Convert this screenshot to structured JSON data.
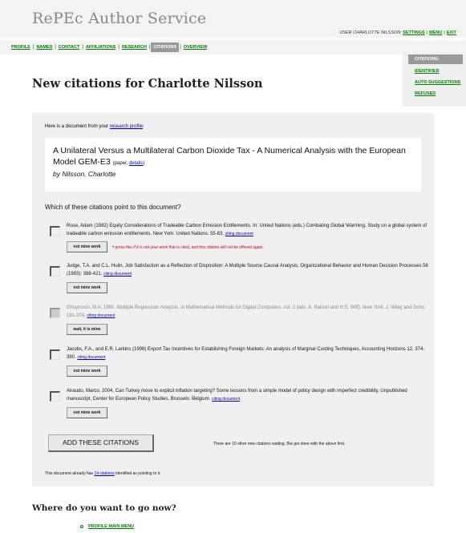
{
  "site": {
    "title": "RePEc Author Service"
  },
  "user_bar": {
    "prefix": "USER",
    "user_name": "CHARLOTTE NILSSON",
    "settings": "SETTINGS",
    "menu": "MENU",
    "exit": "EXIT"
  },
  "nav": {
    "items": [
      {
        "label": "PROFILE"
      },
      {
        "label": "NAMES"
      },
      {
        "label": "CONTACT"
      },
      {
        "label": "AFFILIATIONS"
      },
      {
        "label": "RESEARCH"
      },
      {
        "label": "CITATIONS",
        "active": true
      },
      {
        "label": "OVERVIEW"
      }
    ]
  },
  "side_panel": {
    "heading": "CITATIONS:",
    "links": [
      "IDENTIFIED",
      "AUTO SUGGESTIONS",
      "REFUSED"
    ]
  },
  "page": {
    "title": "New citations for Charlotte Nilsson"
  },
  "document": {
    "intro_prefix": "Here is a document from your",
    "intro_link": "research profile",
    "intro_suffix": ":",
    "title": "A Unilateral Versus a Multilateral Carbon Dioxide Tax - A Numerical Analysis with the European Model GEM-E3",
    "type": "(paper,",
    "details_link": "details",
    "details_suffix": ")",
    "author": "by Nilsson, Charlotte"
  },
  "question": "Which of these citations point to this document?",
  "citations": [
    {
      "text": "Rose, Adam (1992) Equity Considerations of Tradeable Carbon Emission Entitlements. In: United Nations (eds.) Combating Global Warming. Study on a global system of tradeable carbon emission entitlements. New York: United Nations. 55-83.",
      "link": "citing document",
      "button": "not mine work",
      "note_start": "press this",
      "note_em": "if it is not your work",
      "note_end": "that is cited, and this citation will not be offered again.",
      "checked": false
    },
    {
      "text": "Judge, T.A. and C.L. Hulin, Job Satisfaction as a Reflection of Disposition: A Multiple Source Causal Analysis, Organizational Behavior and Human Decision Processes 56 (1993): 388-421.",
      "link": "citing document",
      "button": "not mine work",
      "checked": false
    },
    {
      "text": "Efroymson, M.A. 1960. Multiple Regression Analysis, in Mathematical Methods for Digital Computers. vol. 1 (eds. A. Ralson and H.S. Wilf). New York: J. Wiley and Sons, 191-203.",
      "link": "citing document",
      "button": "wait, it is mine",
      "checked": true
    },
    {
      "text": "Jacobs, F.A., and E.R. Larkins (1998) Export Tax Incentives for Establishing Foreign Markets: An analysis of Marginal Costing Techniques, Accounting Horizons 12, 374-390.",
      "link": "citing document",
      "button": "not mine work",
      "checked": false
    },
    {
      "text": "Airaudo, Marco, 2004, Can Turkey move to explicit inflation targeting? Some lessons from a simple model of policy design with imperfect credibility, Unpublished manuscript, Center for European Policy Studies, Brussels: Belgium.",
      "link": "citing document",
      "button": "not mine work",
      "checked": false
    }
  ],
  "actions": {
    "add_button": "ADD THESE CITATIONS",
    "waiting_text": "There are 10 other new citations waiting. But get done with the above first."
  },
  "already": {
    "prefix": "This document already has",
    "link": "14 citations",
    "suffix": "identified as pointing to it."
  },
  "footer": {
    "heading": "Where do you want to go now?",
    "links": [
      "PROFILE MAIN MENU"
    ]
  }
}
